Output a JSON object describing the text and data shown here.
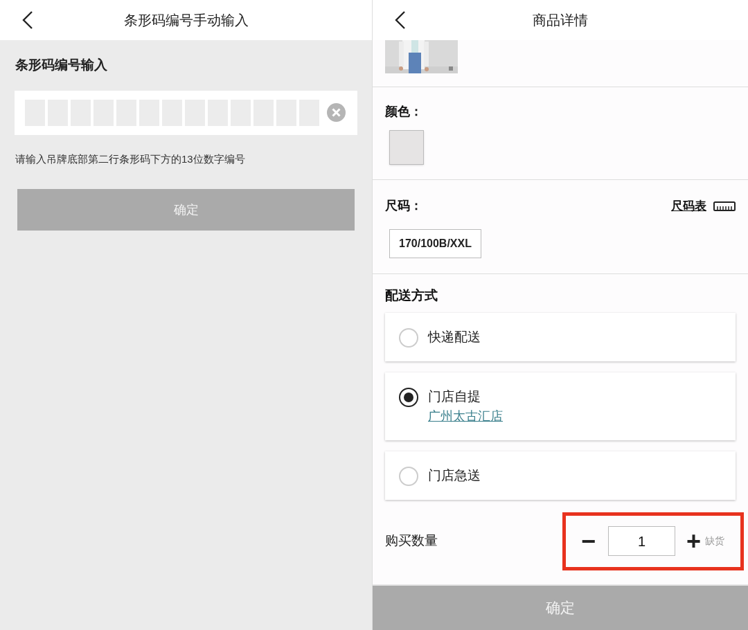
{
  "left_screen": {
    "title": "条形码编号手动输入",
    "section_title": "条形码编号输入",
    "hint": "请输入吊牌底部第二行条形码下方的13位数字编号",
    "confirm_button": {
      "label": "确定",
      "disabled": true
    }
  },
  "right_screen": {
    "title": "商品详情",
    "color": {
      "label": "颜色：",
      "swatches": [
        {
          "color": "#e6e4e4",
          "selected": true
        }
      ]
    },
    "size": {
      "label": "尺码：",
      "chart_link": "尺码表",
      "options": [
        {
          "label": "170/100B/XXL",
          "selected": true
        }
      ]
    },
    "delivery": {
      "title": "配送方式",
      "options": [
        {
          "label": "快递配送",
          "selected": false
        },
        {
          "label": "门店自提",
          "selected": true,
          "store": "广州太古汇店"
        },
        {
          "label": "门店急送",
          "selected": false
        }
      ]
    },
    "quantity": {
      "label": "购买数量",
      "minus": "−",
      "value": "1",
      "plus": "+",
      "note": "缺货",
      "highlighted": true
    },
    "confirm_button": {
      "label": "确定",
      "disabled": true
    }
  }
}
